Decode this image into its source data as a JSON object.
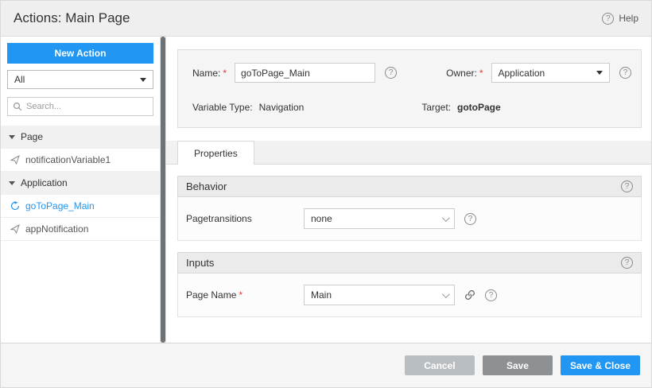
{
  "header": {
    "title": "Actions: Main Page",
    "help_label": "Help"
  },
  "sidebar": {
    "new_action_label": "New Action",
    "filter": {
      "value": "All"
    },
    "search": {
      "placeholder": "Search..."
    },
    "tree": [
      {
        "label": "Page"
      },
      {
        "label": "notificationVariable1"
      },
      {
        "label": "Application"
      },
      {
        "label": "goToPage_Main"
      },
      {
        "label": "appNotification"
      }
    ]
  },
  "form": {
    "name_label": "Name:",
    "required_marker": "*",
    "name_value": "goToPage_Main",
    "owner_label": "Owner:",
    "owner_value": "Application",
    "variable_type_label": "Variable Type:",
    "variable_type_value": "Navigation",
    "target_label": "Target:",
    "target_value": "gotoPage"
  },
  "tabs": {
    "properties_label": "Properties"
  },
  "behavior": {
    "title": "Behavior",
    "pagetransitions_label": "Pagetransitions",
    "pagetransitions_value": "none"
  },
  "inputs": {
    "title": "Inputs",
    "page_name_label": "Page Name",
    "page_name_value": "Main"
  },
  "footer": {
    "cancel_label": "Cancel",
    "save_label": "Save",
    "save_close_label": "Save & Close"
  },
  "colors": {
    "accent": "#2196f3",
    "required": "#e53935",
    "cancel_button": "#b9bec2",
    "save_button": "#8d9194"
  }
}
